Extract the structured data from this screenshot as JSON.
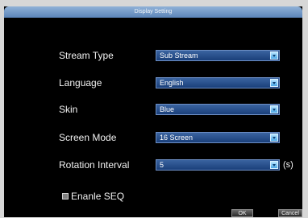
{
  "window": {
    "title": "Display Setting"
  },
  "fields": [
    {
      "label": "Stream Type",
      "value": "Sub Stream"
    },
    {
      "label": "Language",
      "value": "English"
    },
    {
      "label": "Skin",
      "value": "Blue"
    },
    {
      "label": "Screen Mode",
      "value": "16 Screen"
    },
    {
      "label": "Rotation Interval",
      "value": "5",
      "unit": "(s)"
    }
  ],
  "seq": {
    "label": "Enanle SEQ",
    "checked": false
  },
  "buttons": {
    "ok": "OK",
    "cancel": "Cancel"
  },
  "colors": {
    "title_bar": "#5b84b9",
    "dropdown": "#1a3f7a",
    "background": "#000000"
  }
}
